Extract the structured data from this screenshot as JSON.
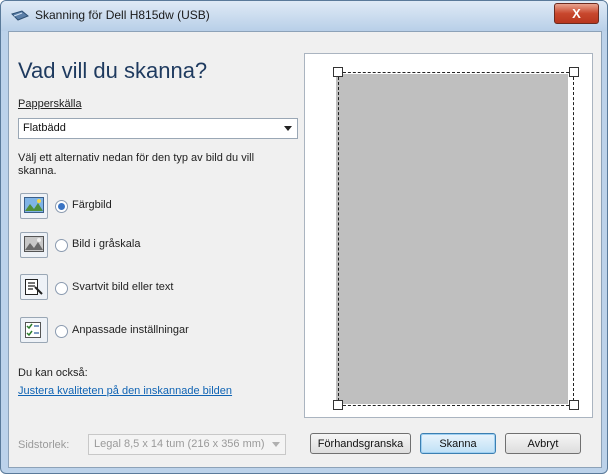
{
  "window": {
    "title": "Skanning för Dell H815dw (USB)",
    "close_glyph": "X"
  },
  "left": {
    "heading": "Vad vill du skanna?",
    "source_label": "Papperskälla",
    "source_value": "Flatbädd",
    "instruction_line1": "Välj ett alternativ nedan för den typ av bild du vill",
    "instruction_line2": "skanna.",
    "options": [
      {
        "label": "Färgbild",
        "selected": true,
        "icon": "color-picture-icon"
      },
      {
        "label": "Bild i gråskala",
        "selected": false,
        "icon": "grayscale-picture-icon"
      },
      {
        "label": "Svartvit bild eller text",
        "selected": false,
        "icon": "bw-text-icon"
      },
      {
        "label": "Anpassade inställningar",
        "selected": false,
        "icon": "custom-settings-icon"
      }
    ],
    "also_label": "Du kan också:",
    "quality_link": "Justera kvaliteten på den inskannade bilden"
  },
  "bottom": {
    "page_size_label": "Sidstorlek:",
    "page_size_value": "Legal 8,5 x 14 tum (216 x 356 mm)",
    "preview_button": "Förhandsgranska",
    "scan_button": "Skanna",
    "cancel_button": "Avbryt"
  },
  "colors": {
    "heading": "#1e3a5f",
    "link": "#1064b4",
    "scan_area": "#bfbfbf",
    "close_button": "#c8472d"
  }
}
